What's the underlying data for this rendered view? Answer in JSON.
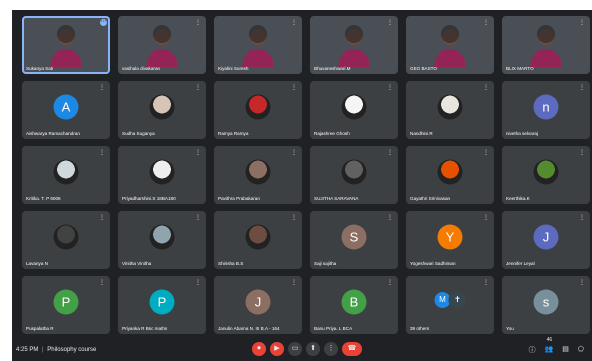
{
  "meeting": {
    "time": "4:25 PM",
    "separator": "|",
    "title": "Philosophy course"
  },
  "tiles": [
    {
      "name": "Sukanya Sati",
      "kind": "video",
      "active": true
    },
    {
      "name": "vasihala divakaran",
      "kind": "video"
    },
    {
      "name": "Kiyalini Suresh",
      "kind": "video"
    },
    {
      "name": "Bhuvaneshwari.M",
      "kind": "video"
    },
    {
      "name": "GEO BASTO",
      "kind": "video"
    },
    {
      "name": "BLIX MARTO",
      "kind": "video"
    },
    {
      "name": "Aishwarya Ramachandran",
      "kind": "avatar",
      "letter": "A",
      "color": "#1e88e5"
    },
    {
      "name": "Sudha Suganya",
      "kind": "photo",
      "color": "#d7c4b8"
    },
    {
      "name": "Ramya Ramya",
      "kind": "photo",
      "color": "#c62828"
    },
    {
      "name": "Rajashree Ghosh",
      "kind": "photo",
      "color": "#f5f5f5"
    },
    {
      "name": "Nandhini.R",
      "kind": "photo",
      "color": "#e8e4de"
    },
    {
      "name": "nivetha selvaraj",
      "kind": "avatar",
      "letter": "n",
      "color": "#5c6bc0"
    },
    {
      "name": "Kritika. T. P 6006",
      "kind": "photo",
      "color": "#cfd8dc"
    },
    {
      "name": "Priyadharshini.S 18BA180",
      "kind": "photo",
      "color": "#eeeeee"
    },
    {
      "name": "Pavithra Prabakaran",
      "kind": "photo",
      "color": "#8d6e63"
    },
    {
      "name": "SUJITHA SARAVANA",
      "kind": "photo",
      "color": "#616161"
    },
    {
      "name": "Gayathri Srinivasan",
      "kind": "photo",
      "color": "#e65100"
    },
    {
      "name": "Keerthika.K",
      "kind": "photo",
      "color": "#558b2f"
    },
    {
      "name": "Lavanya N",
      "kind": "photo",
      "color": "#424242"
    },
    {
      "name": "Vinitha Vinitha",
      "kind": "photo",
      "color": "#90a4ae"
    },
    {
      "name": "Shirisha B.S",
      "kind": "photo",
      "color": "#6d4c41"
    },
    {
      "name": "Saji sajitha",
      "kind": "avatar",
      "letter": "S",
      "color": "#8d6e63"
    },
    {
      "name": "Yogeshwari Sadhiman",
      "kind": "avatar",
      "letter": "Y",
      "color": "#f57c00"
    },
    {
      "name": "Jennifer Leyal",
      "kind": "avatar",
      "letter": "J",
      "color": "#5c6bc0"
    },
    {
      "name": "Puspalatha R",
      "kind": "avatar",
      "letter": "P",
      "color": "#43a047"
    },
    {
      "name": "Priyanka R Bsc maths",
      "kind": "avatar",
      "letter": "P",
      "color": "#00acc1"
    },
    {
      "name": "Janulin Abarna N. III B.A - 164",
      "kind": "avatar",
      "letter": "J",
      "color": "#8d6e63"
    },
    {
      "name": "Banu Priya. L BCA",
      "kind": "avatar",
      "letter": "B",
      "color": "#43a047"
    },
    {
      "name": "39 others",
      "kind": "others",
      "letters": [
        "M",
        "✝"
      ],
      "colors": [
        "#1e88e5",
        "#37474f"
      ]
    },
    {
      "name": "You",
      "kind": "avatar",
      "letter": "s",
      "color": "#78909c"
    }
  ],
  "controls": [
    {
      "name": "mic-button",
      "icon": "mic-off-icon",
      "glyph": "⏺",
      "red": true
    },
    {
      "name": "camera-button",
      "icon": "camera-off-icon",
      "glyph": "▶",
      "red": true
    },
    {
      "name": "captions-button",
      "icon": "captions-icon",
      "glyph": "▭"
    },
    {
      "name": "present-button",
      "icon": "present-icon",
      "glyph": "⬆"
    },
    {
      "name": "more-options-button",
      "icon": "more-vert-icon",
      "glyph": "⋮"
    },
    {
      "name": "end-call-button",
      "icon": "end-call-icon",
      "glyph": "☎",
      "end": true
    }
  ],
  "right_icons": [
    {
      "name": "info-button",
      "icon": "info-icon",
      "glyph": "ⓘ"
    },
    {
      "name": "people-button",
      "icon": "people-icon",
      "glyph": "👥",
      "badge": "46"
    },
    {
      "name": "chat-button",
      "icon": "chat-icon",
      "glyph": "▤"
    },
    {
      "name": "activities-button",
      "icon": "activities-icon",
      "glyph": "⬠"
    }
  ]
}
